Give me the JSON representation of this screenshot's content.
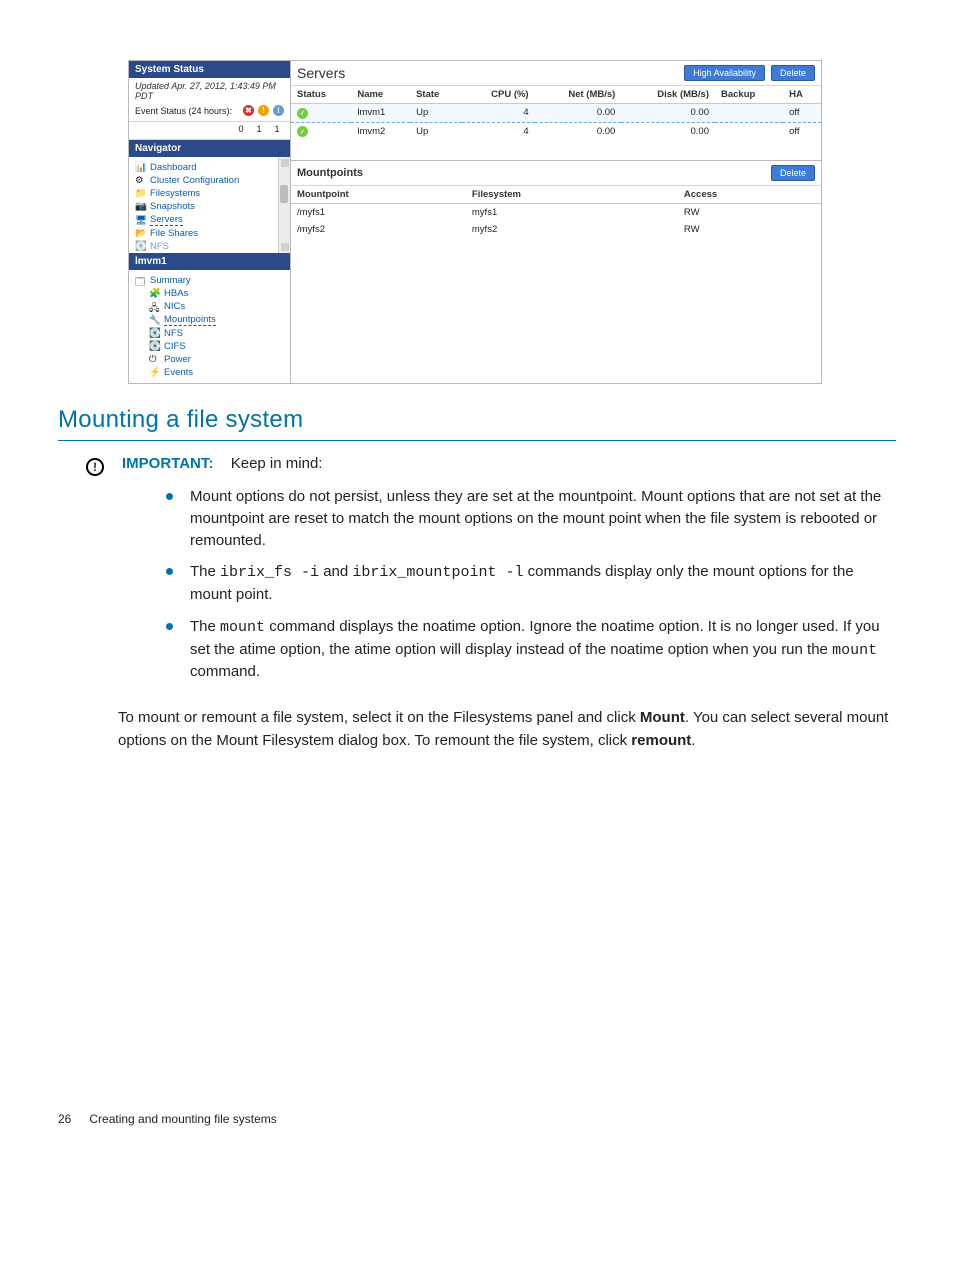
{
  "left": {
    "systemStatus": "System Status",
    "updated": "Updated Apr. 27, 2012, 1:43:49 PM PDT",
    "eventStatusLabel": "Event Status (24 hours):",
    "ev_err": "0",
    "ev_warn": "1",
    "ev_info": "1",
    "navigator": "Navigator",
    "navItems": {
      "0": "Dashboard",
      "1": "Cluster Configuration",
      "2": "Filesystems",
      "3": "Snapshots",
      "4": "Servers",
      "5": "File Shares",
      "6": "NFS"
    },
    "subHeader": "lmvm1",
    "subItems": {
      "0": "Summary",
      "1": "HBAs",
      "2": "NICs",
      "3": "Mountpoints",
      "4": "NFS",
      "5": "CIFS",
      "6": "Power",
      "7": "Events"
    }
  },
  "servers": {
    "title": "Servers",
    "btnHA": "High Availability",
    "btnDel": "Delete",
    "cols": {
      "status": "Status",
      "name": "Name",
      "state": "State",
      "cpu": "CPU (%)",
      "net": "Net (MB/s)",
      "disk": "Disk (MB/s)",
      "backup": "Backup",
      "ha": "HA"
    },
    "rows": {
      "0": {
        "name": "lmvm1",
        "state": "Up",
        "cpu": "4",
        "net": "0.00",
        "disk": "0.00",
        "backup": "",
        "ha": "off"
      },
      "1": {
        "name": "lmvm2",
        "state": "Up",
        "cpu": "4",
        "net": "0.00",
        "disk": "0.00",
        "backup": "",
        "ha": "off"
      }
    }
  },
  "mount": {
    "title": "Mountpoints",
    "btnDel": "Delete",
    "cols": {
      "mp": "Mountpoint",
      "fs": "Filesystem",
      "ac": "Access"
    },
    "rows": {
      "0": {
        "mp": "/myfs1",
        "fs": "myfs1",
        "ac": "RW"
      },
      "1": {
        "mp": "/myfs2",
        "fs": "myfs2",
        "ac": "RW"
      }
    }
  },
  "doc": {
    "h2": "Mounting a file system",
    "important": "IMPORTANT:",
    "keep": "Keep in mind:",
    "b1": "Mount options do not persist, unless they are set at the mountpoint. Mount options that are not set at the mountpoint are reset to match the mount options on the mount point when the file system is rebooted or remounted.",
    "b2a": "The ",
    "b2code1": "ibrix_fs -i",
    "b2b": " and ",
    "b2code2": "ibrix_mountpoint -l",
    "b2c": " commands display only the mount options for the mount point.",
    "b3a": "The ",
    "b3code1": "mount",
    "b3b": " command displays the noatime option. Ignore the noatime option. It is no longer used. If you set the atime option, the atime option will display instead of the noatime option when you run the ",
    "b3code2": "mount",
    "b3c": " command.",
    "p1a": "To mount or remount a file system, select it on the Filesystems panel and click ",
    "p1b": "Mount",
    "p1c": ". You can select several mount options on the Mount Filesystem dialog box. To remount the file system, click ",
    "p1d": "remount",
    "p1e": ".",
    "pageNum": "26",
    "footerText": "Creating and mounting file systems"
  }
}
